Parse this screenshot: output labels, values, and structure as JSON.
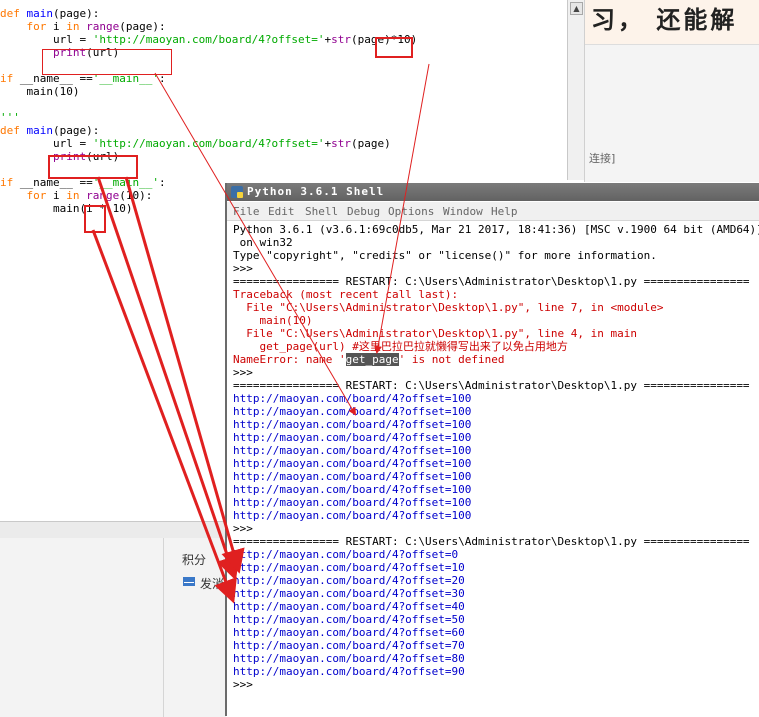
{
  "editor": {
    "lines": [
      [
        {
          "t": "'''",
          "c": "str"
        }
      ],
      [
        {
          "t": "def ",
          "c": "kw"
        },
        {
          "t": "main",
          "c": "fn"
        },
        {
          "t": "(page):",
          "c": "tx"
        }
      ],
      [
        {
          "t": "    ",
          "c": "tx"
        },
        {
          "t": "for",
          "c": "kw"
        },
        {
          "t": " i ",
          "c": "tx"
        },
        {
          "t": "in",
          "c": "kw"
        },
        {
          "t": " ",
          "c": "tx"
        },
        {
          "t": "range",
          "c": "bi"
        },
        {
          "t": "(page):",
          "c": "tx"
        }
      ],
      [
        {
          "t": "        url = ",
          "c": "tx"
        },
        {
          "t": "'http://maoyan.com/board/4?offset='",
          "c": "str"
        },
        {
          "t": "+",
          "c": "tx"
        },
        {
          "t": "str",
          "c": "bi"
        },
        {
          "t": "(page)*10)",
          "c": "tx"
        }
      ],
      [
        {
          "t": "        ",
          "c": "tx"
        },
        {
          "t": "print",
          "c": "bi"
        },
        {
          "t": "(url)",
          "c": "tx"
        }
      ],
      [
        {
          "t": "",
          "c": "tx"
        }
      ],
      [
        {
          "t": "if",
          "c": "kw"
        },
        {
          "t": " __name__ ==",
          "c": "tx"
        },
        {
          "t": "'__main__'",
          "c": "str"
        },
        {
          "t": ":",
          "c": "tx"
        }
      ],
      [
        {
          "t": "    main(10)",
          "c": "tx"
        }
      ],
      [
        {
          "t": "",
          "c": "tx"
        }
      ],
      [
        {
          "t": "'''",
          "c": "str"
        }
      ],
      [
        {
          "t": "def ",
          "c": "kw"
        },
        {
          "t": "main",
          "c": "fn"
        },
        {
          "t": "(page):",
          "c": "tx"
        }
      ],
      [
        {
          "t": "        url = ",
          "c": "tx"
        },
        {
          "t": "'http://maoyan.com/board/4?offset='",
          "c": "str"
        },
        {
          "t": "+",
          "c": "tx"
        },
        {
          "t": "str",
          "c": "bi"
        },
        {
          "t": "(page)",
          "c": "tx"
        }
      ],
      [
        {
          "t": "        ",
          "c": "tx"
        },
        {
          "t": "print",
          "c": "bi"
        },
        {
          "t": "(url)",
          "c": "tx"
        }
      ],
      [
        {
          "t": "",
          "c": "tx"
        }
      ],
      [
        {
          "t": "if",
          "c": "kw"
        },
        {
          "t": " __name__ ==",
          "c": "tx"
        },
        {
          "t": "'__main__'",
          "c": "str"
        },
        {
          "t": ":",
          "c": "tx"
        }
      ],
      [
        {
          "t": "    ",
          "c": "tx"
        },
        {
          "t": "for",
          "c": "kw"
        },
        {
          "t": " i ",
          "c": "tx"
        },
        {
          "t": "in",
          "c": "kw"
        },
        {
          "t": " ",
          "c": "tx"
        },
        {
          "t": "range",
          "c": "bi"
        },
        {
          "t": "(10):",
          "c": "tx"
        }
      ],
      [
        {
          "t": "        main(i * 10)",
          "c": "tx"
        }
      ]
    ]
  },
  "right_pane": {
    "banner_text": "习， 还能解",
    "link_text": "连接]"
  },
  "bottom_pane": {
    "score_label": "积分",
    "send_label": "发消"
  },
  "shell": {
    "title": "Python 3.6.1 Shell",
    "menu": [
      "File",
      "Edit",
      "Shell",
      "Debug",
      "Options",
      "Window",
      "Help"
    ],
    "console": [
      {
        "t": "Python 3.6.1 (v3.6.1:69c0db5, Mar 21 2017, 18:41:36) [MSC v.1900 64 bit (AMD64)]",
        "c": "out"
      },
      {
        "t": " on win32",
        "c": "out"
      },
      {
        "t": "Type \"copyright\", \"credits\" or \"license()\" for more information.",
        "c": "out"
      },
      {
        "t": ">>> ",
        "c": "out"
      },
      {
        "t": "================ RESTART: C:\\Users\\Administrator\\Desktop\\1.py ================",
        "c": "out"
      },
      {
        "t": "Traceback (most recent call last):",
        "c": "err"
      },
      {
        "t": "  File \"C:\\Users\\Administrator\\Desktop\\1.py\", line 7, in <module>",
        "c": "err"
      },
      {
        "t": "    main(10)",
        "c": "err"
      },
      {
        "t": "  File \"C:\\Users\\Administrator\\Desktop\\1.py\", line 4, in main",
        "c": "err"
      },
      {
        "t": "    get_page(url) #这里巴拉巴拉就懒得写出来了以免占用地方",
        "c": "err"
      },
      {
        "t": "NameError: name '",
        "c": "err",
        "hl": "get_page",
        "rest": "' is not defined"
      },
      {
        "t": ">>> ",
        "c": "out"
      },
      {
        "t": "================ RESTART: C:\\Users\\Administrator\\Desktop\\1.py ================",
        "c": "out"
      },
      {
        "t": "http://maoyan.com/board/4?offset=100",
        "c": "url"
      },
      {
        "t": "http://maoyan.com/board/4?offset=100",
        "c": "url"
      },
      {
        "t": "http://maoyan.com/board/4?offset=100",
        "c": "url"
      },
      {
        "t": "http://maoyan.com/board/4?offset=100",
        "c": "url"
      },
      {
        "t": "http://maoyan.com/board/4?offset=100",
        "c": "url"
      },
      {
        "t": "http://maoyan.com/board/4?offset=100",
        "c": "url"
      },
      {
        "t": "http://maoyan.com/board/4?offset=100",
        "c": "url"
      },
      {
        "t": "http://maoyan.com/board/4?offset=100",
        "c": "url"
      },
      {
        "t": "http://maoyan.com/board/4?offset=100",
        "c": "url"
      },
      {
        "t": "http://maoyan.com/board/4?offset=100",
        "c": "url"
      },
      {
        "t": ">>> ",
        "c": "out"
      },
      {
        "t": "================ RESTART: C:\\Users\\Administrator\\Desktop\\1.py ================",
        "c": "out"
      },
      {
        "t": "http://maoyan.com/board/4?offset=0",
        "c": "url"
      },
      {
        "t": "http://maoyan.com/board/4?offset=10",
        "c": "url"
      },
      {
        "t": "http://maoyan.com/board/4?offset=20",
        "c": "url"
      },
      {
        "t": "http://maoyan.com/board/4?offset=30",
        "c": "url"
      },
      {
        "t": "http://maoyan.com/board/4?offset=40",
        "c": "url"
      },
      {
        "t": "http://maoyan.com/board/4?offset=50",
        "c": "url"
      },
      {
        "t": "http://maoyan.com/board/4?offset=60",
        "c": "url"
      },
      {
        "t": "http://maoyan.com/board/4?offset=70",
        "c": "url"
      },
      {
        "t": "http://maoyan.com/board/4?offset=80",
        "c": "url"
      },
      {
        "t": "http://maoyan.com/board/4?offset=90",
        "c": "url"
      },
      {
        "t": ">>> ",
        "c": "out"
      }
    ]
  },
  "colors": {
    "annotation": "#e02020",
    "keyword": "#ff7700",
    "string": "#00aa00",
    "builtin": "#900090",
    "error": "#cc0000",
    "output_url": "#0000cc"
  }
}
